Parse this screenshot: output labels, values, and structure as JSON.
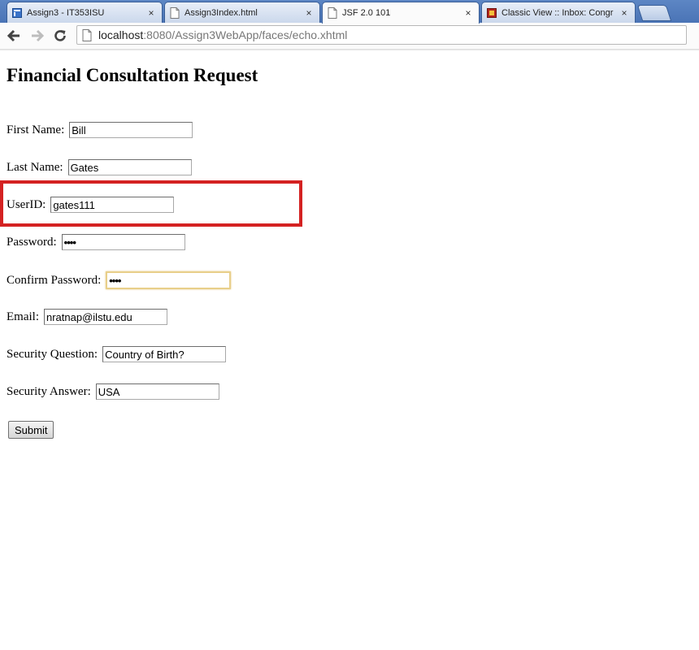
{
  "browser": {
    "tabs": [
      {
        "label": "Assign3 - IT353ISU",
        "icon": "site-favicon-icon",
        "active": false
      },
      {
        "label": "Assign3Index.html",
        "icon": "page-icon",
        "active": false
      },
      {
        "label": "JSF 2.0 101",
        "icon": "page-icon",
        "active": true
      },
      {
        "label": "Classic View :: Inbox: Congr",
        "icon": "mail-favicon-icon",
        "active": false
      }
    ],
    "tab_close_glyph": "×",
    "url_host": "localhost",
    "url_rest": ":8080/Assign3WebApp/faces/echo.xhtml"
  },
  "page": {
    "title": "Financial Consultation Request",
    "fields": {
      "first_name": {
        "label": "First Name:",
        "value": "Bill"
      },
      "last_name": {
        "label": "Last Name:",
        "value": "Gates"
      },
      "user_id": {
        "label": "UserID:",
        "value": "gates111"
      },
      "password": {
        "label": "Password:",
        "value": "••••"
      },
      "confirm_password": {
        "label": "Confirm Password:",
        "value": "••••"
      },
      "email": {
        "label": "Email:",
        "value": "nratnap@ilstu.edu"
      },
      "security_question": {
        "label": "Security Question:",
        "value": "Country of Birth?"
      },
      "security_answer": {
        "label": "Security Answer:",
        "value": "USA"
      }
    },
    "submit_label": "Submit",
    "highlight_color": "#d42222"
  }
}
